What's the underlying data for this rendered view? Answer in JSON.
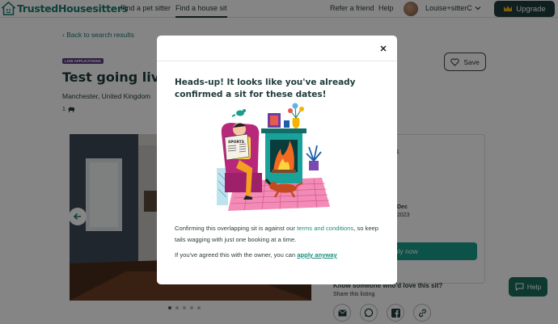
{
  "header": {
    "logo_text": "TrustedHousesitters",
    "nav": [
      "Find a pet sitter",
      "Find a house sit"
    ],
    "refer": "Refer a friend",
    "help": "Help",
    "user": "Louise+sitterC",
    "upgrade": "Upgrade"
  },
  "listing": {
    "back": "Back to search results",
    "badge": "LOW APPLICATIONS",
    "title": "Test going live",
    "location": "Manchester, United Kingdom",
    "pet_count": "1",
    "save": "Save",
    "side_value": "01",
    "date_month": "Dec",
    "date_year": "2023",
    "apply": "Apply now",
    "know": "Know someone who'd love this sit?",
    "share": "Share this listing"
  },
  "help_button": "Help",
  "modal": {
    "title": "Heads-up! It looks like you've already confirmed a sit for these dates!",
    "p1_before": "Confirming this overlapping sit is against our ",
    "p1_link": "terms and conditions",
    "p1_after": ", so keep tails wagging with just one booking at a time.",
    "p2_before": "If you've agreed this with the owner, you can ",
    "p2_link": "apply anyway"
  },
  "colors": {
    "brand": "#1a7c6e",
    "upgrade_bg": "#1f3f3e",
    "apply_bg": "#1a9e8a",
    "badge_bg": "#5b3f82"
  }
}
